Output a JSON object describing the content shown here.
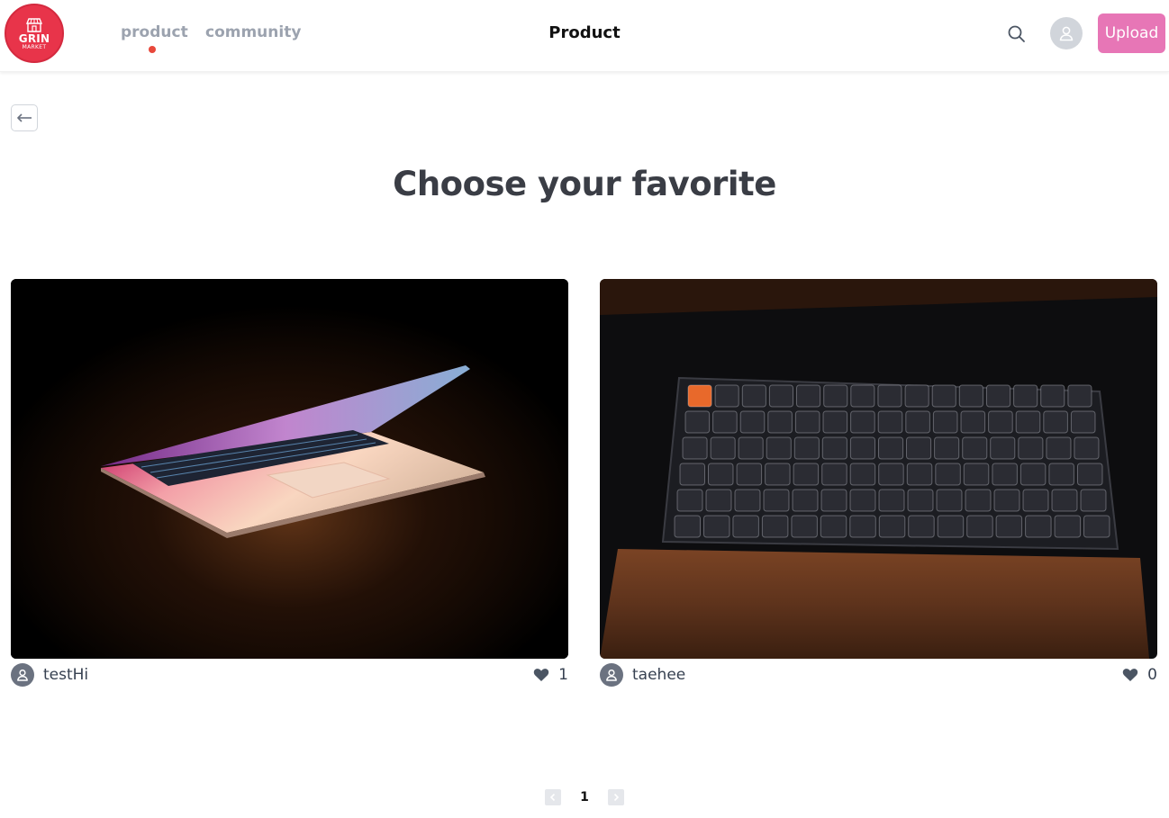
{
  "logo": {
    "brand": "GRIN",
    "sub": "MARKET",
    "color": "#e8344a"
  },
  "nav": {
    "items": [
      {
        "label": "product",
        "active": true
      },
      {
        "label": "community",
        "active": false
      }
    ],
    "active_indicator_color": "#e8483b"
  },
  "header": {
    "title": "Product",
    "search_icon": "search-icon",
    "avatar_icon": "user-icon",
    "upload_label": "Upload",
    "upload_color": "#e776b6"
  },
  "back": {
    "icon": "arrow-left-icon"
  },
  "main": {
    "heading": "Choose your favorite",
    "products": [
      {
        "author": "testHi",
        "likes": "1",
        "image": "laptop photo"
      },
      {
        "author": "taehee",
        "likes": "0",
        "image": "mechanical keyboard photo"
      }
    ]
  },
  "pagination": {
    "current": "1",
    "prev_icon": "chevron-left-icon",
    "next_icon": "chevron-right-icon"
  }
}
